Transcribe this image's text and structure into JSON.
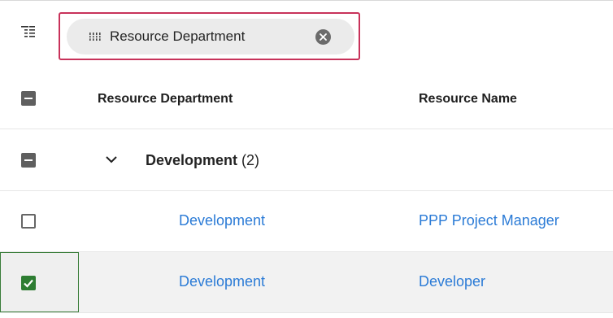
{
  "group_bar": {
    "chip_label": "Resource Department"
  },
  "columns": {
    "department": "Resource Department",
    "name": "Resource Name"
  },
  "group": {
    "title": "Development",
    "count": "(2)"
  },
  "rows": [
    {
      "department": "Development",
      "name": "PPP Project Manager",
      "selected": false
    },
    {
      "department": "Development",
      "name": "Developer",
      "selected": true
    }
  ],
  "colors": {
    "accent_outline": "#c8325a",
    "link": "#2b7bd6",
    "checked": "#2e7d32"
  }
}
